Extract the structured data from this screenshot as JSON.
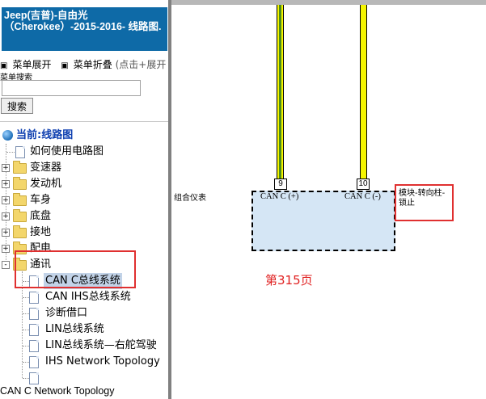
{
  "nav": {
    "header": "Jeep(吉普)-自由光（Cherokee）-2015-2016- 线路图.",
    "menu_expand": "菜单展开",
    "menu_collapse": "菜单折叠",
    "menu_hint": "(点击+展开",
    "toggle_glyph": "▣",
    "search_label": "菜单搜索",
    "search_value": "",
    "search_button": "搜索",
    "tree": {
      "current": "当前:线路图",
      "items": [
        {
          "label": "如何使用电路图",
          "type": "doc"
        },
        {
          "label": "变速器",
          "type": "folder"
        },
        {
          "label": "发动机",
          "type": "folder"
        },
        {
          "label": "车身",
          "type": "folder"
        },
        {
          "label": "底盘",
          "type": "folder"
        },
        {
          "label": "接地",
          "type": "folder"
        },
        {
          "label": "配电",
          "type": "folder"
        },
        {
          "label": "通讯",
          "type": "folder",
          "expanded": true
        }
      ],
      "children": [
        {
          "label": "CAN C总线系统",
          "selected": true
        },
        {
          "label": "CAN IHS总线系统"
        },
        {
          "label": "诊断借口"
        },
        {
          "label": "LIN总线系统"
        },
        {
          "label": "LIN总线系统—右舵驾驶"
        },
        {
          "label": "IHS Network Topology"
        },
        {
          "label": ""
        }
      ],
      "expand_glyph": "+",
      "collapse_glyph": "-"
    },
    "bottom_item": "CAN C Network Topology"
  },
  "diagram": {
    "module_label": "组合仪表",
    "pin_9": "9",
    "pin_10": "10",
    "can_high": "CAN C (+)",
    "can_low": "CAN C (-)",
    "reference": "模块-转向柱-锁止",
    "page_number": "第315页"
  },
  "colors": {
    "header_bg": "#0e6aa7",
    "wire_yellow": "#f5f500",
    "wire_green": "#4a8a1c",
    "module_fill": "#d5e6f5",
    "annotation_red": "#e03030"
  }
}
